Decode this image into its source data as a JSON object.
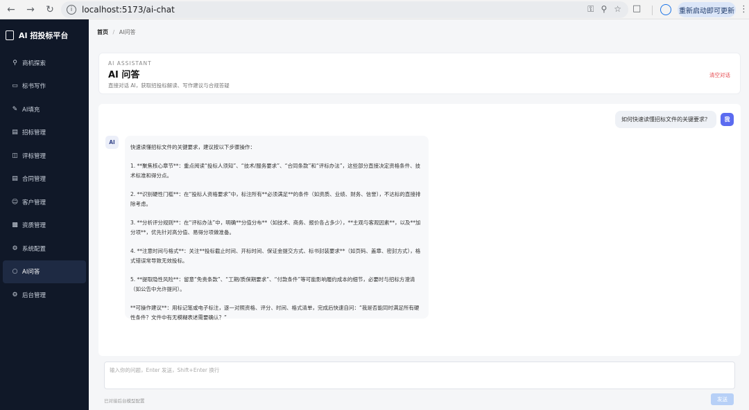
{
  "browser": {
    "url": "localhost:5173/ai-chat",
    "update_button": "重新启动即可更新"
  },
  "sidebar": {
    "brand": "AI 招投标平台",
    "items": [
      {
        "label": "商机探索",
        "icon": "search-icon"
      },
      {
        "label": "标书写作",
        "icon": "folder-icon"
      },
      {
        "label": "AI填充",
        "icon": "pen-icon"
      },
      {
        "label": "招标管理",
        "icon": "file-icon"
      },
      {
        "label": "评标管理",
        "icon": "monitor-icon"
      },
      {
        "label": "合同管理",
        "icon": "document-icon"
      },
      {
        "label": "客户管理",
        "icon": "user-icon"
      },
      {
        "label": "资质管理",
        "icon": "cylinder-icon"
      },
      {
        "label": "系统配置",
        "icon": "gear-icon"
      },
      {
        "label": "AI问答",
        "icon": "chat-icon",
        "active": true
      },
      {
        "label": "后台管理",
        "icon": "settings-icon"
      }
    ]
  },
  "breadcrumb": {
    "home": "首页",
    "separator": "/",
    "current": "AI问答"
  },
  "header": {
    "eyebrow": "AI ASSISTANT",
    "title": "AI 问答",
    "subtitle": "直接对话 AI，获取招投标解读、写作建议与合规答疑",
    "clear_label": "清空对话"
  },
  "chat": {
    "user_avatar": "我",
    "user_message": "如何快速读懂招标文件的关键要求？",
    "ai_avatar": "AI",
    "ai_paragraphs": [
      "快速读懂招标文件的关键要求，建议按以下步骤操作：",
      "1. **聚焦核心章节**：重点阅读“投标人须知”、“技术/服务要求”、“合同条款”和“评标办法”，这些部分直接决定资格条件、技术标准和得分点。",
      "2. **识别硬性门槛**：在“投标人资格要求”中，标注所有**必须满足**的条件（如资质、业绩、财务、信誉），不达标的直接排除考虑。",
      "3. **分析评分规则**：在“评标办法”中，明确**分值分布**（如技术、商务、报价各占多少），**主观与客观因素**，以及**加分项**，优先针对高分值、易得分项做准备。",
      "4. **注意时间与格式**：关注**投标截止时间、开标时间、保证金提交方式、标书封装要求**（如页码、盖章、密封方式），格式错误常导致无效投标。",
      "5. **提取隐性风险**：留意“免责条款”、“工期/质保期要求”、“付款条件”等可能影响履约成本的细节，必要时与招标方澄清（如公告中允许提问）。",
      "**可操作建议**：用标记笔或电子标注，逐一对照资格、评分、时间、格式清单，完成后快速自问：“我是否能同时满足所有硬性条件？文件中有无模糊表述需要确认？”"
    ]
  },
  "composer": {
    "placeholder": "输入你的问题，Enter 发送，Shift+Enter 换行",
    "footer_hint": "已对接后台模型配置",
    "send_label": "发送"
  }
}
